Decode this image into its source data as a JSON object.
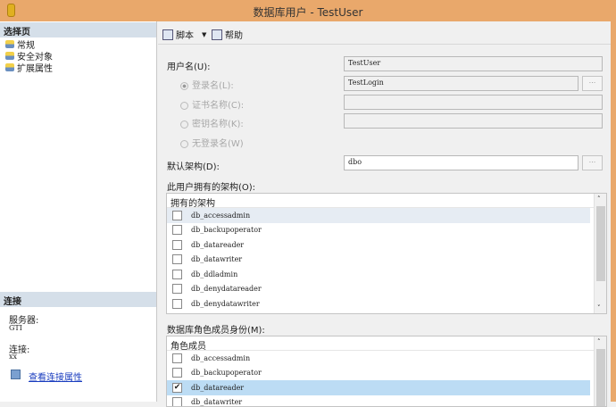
{
  "window": {
    "title": "数据库用户 - TestUser"
  },
  "left": {
    "select_page_header": "选择页",
    "pages": [
      {
        "label": "常规"
      },
      {
        "label": "安全对象"
      },
      {
        "label": "扩展属性"
      }
    ],
    "connection_header": "连接",
    "server_label": "服务器:",
    "server_value": "GTI",
    "connection_label": "连接:",
    "connection_value": "xx",
    "view_props_link": "查看连接属性"
  },
  "toolbar": {
    "script": "脚本",
    "help": "帮助"
  },
  "form": {
    "username_label": "用户名(U):",
    "username_value": "TestUser",
    "login_label": "登录名(L):",
    "login_value": "TestLogin",
    "cert_label": "证书名称(C):",
    "key_label": "密钥名称(K):",
    "nologin_label": "无登录名(W)",
    "browse": "...",
    "schema_label": "默认架构(D):",
    "schema_value": "dbo",
    "owned_label": "此用户拥有的架构(O):",
    "owned_header": "拥有的架构",
    "owned": [
      {
        "name": "db_accessadmin",
        "checked": false
      },
      {
        "name": "db_backupoperator",
        "checked": false
      },
      {
        "name": "db_datareader",
        "checked": false
      },
      {
        "name": "db_datawriter",
        "checked": false
      },
      {
        "name": "db_ddladmin",
        "checked": false
      },
      {
        "name": "db_denydatareader",
        "checked": false
      },
      {
        "name": "db_denydatawriter",
        "checked": false
      }
    ],
    "roles_label": "数据库角色成员身份(M):",
    "roles_header": "角色成员",
    "roles": [
      {
        "name": "db_accessadmin",
        "checked": false
      },
      {
        "name": "db_backupoperator",
        "checked": false
      },
      {
        "name": "db_datareader",
        "checked": true
      },
      {
        "name": "db_datawriter",
        "checked": false
      }
    ]
  }
}
